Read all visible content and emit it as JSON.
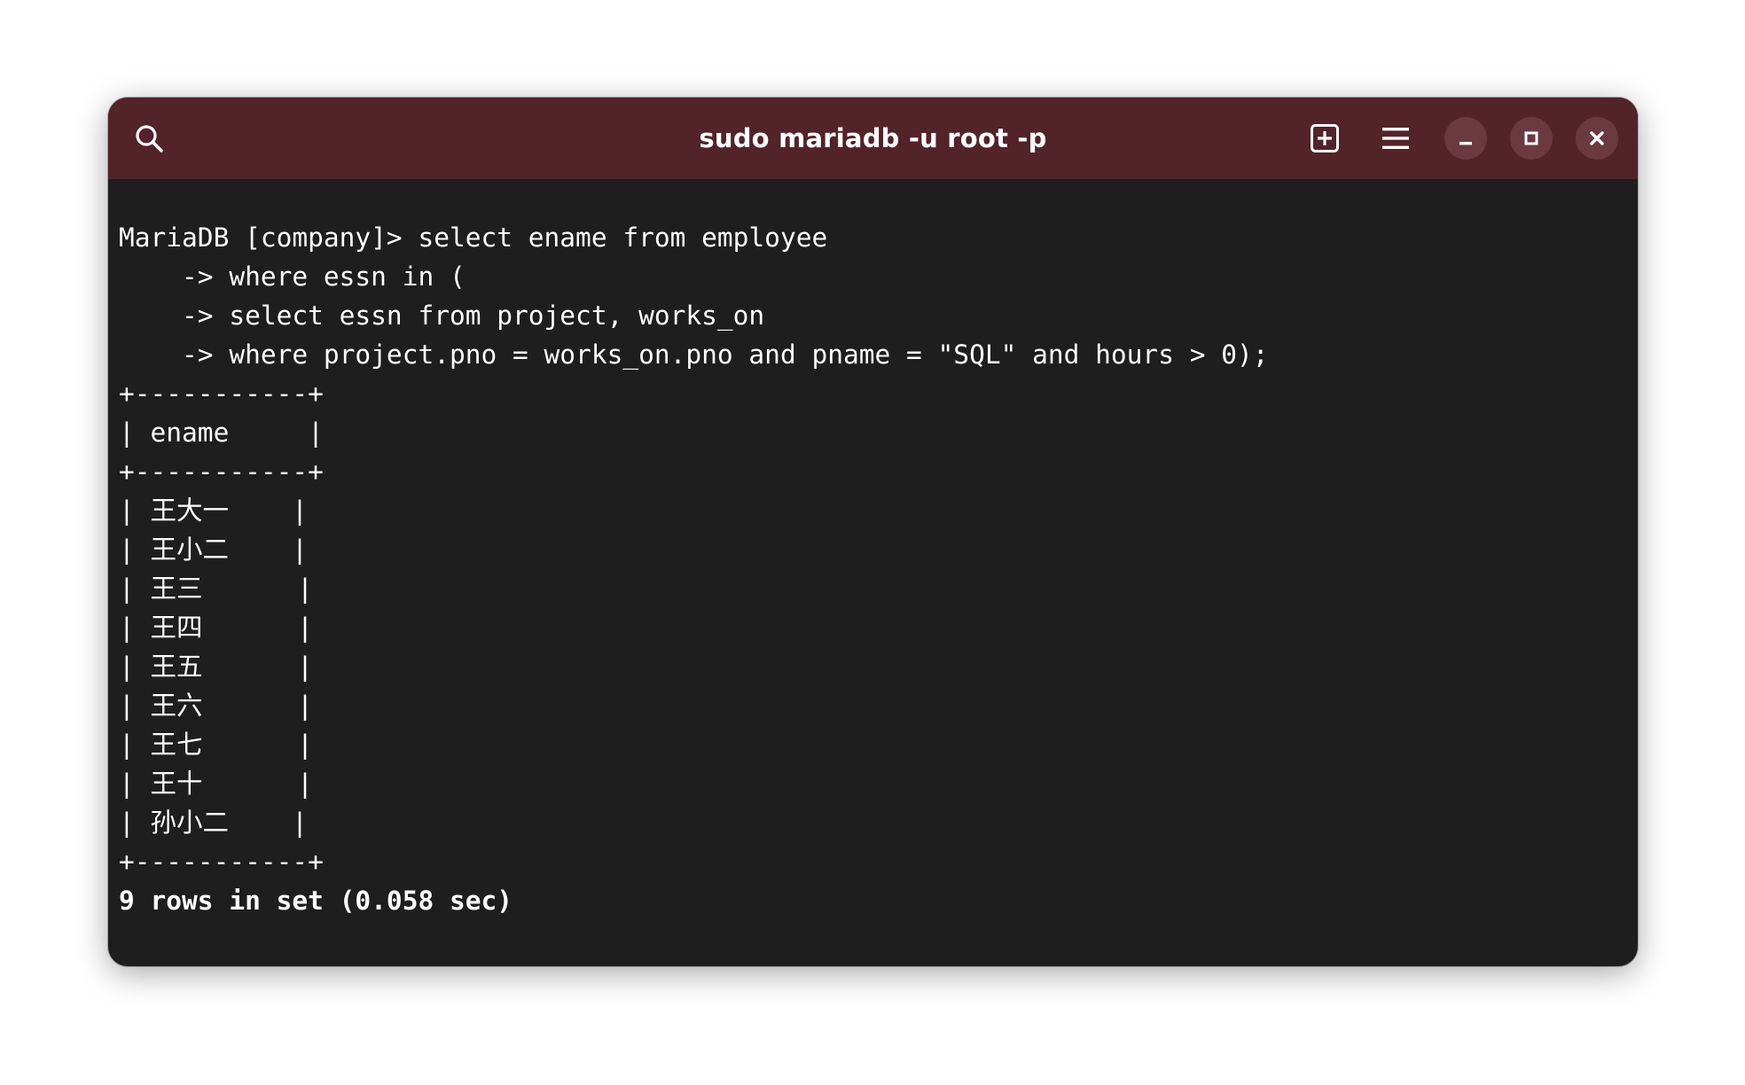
{
  "window": {
    "title": "sudo mariadb -u root -p",
    "titlebar_color": "#522329",
    "background_color": "#1e1e1e"
  },
  "icons": {
    "search": "search-icon",
    "new_tab": "new-tab-icon",
    "menu": "hamburger-menu-icon",
    "minimize": "minimize-icon",
    "maximize": "maximize-icon",
    "close": "close-icon"
  },
  "terminal": {
    "lines": [
      "MariaDB [company]> select ename from employee",
      "    -> where essn in (",
      "    -> select essn from project, works_on",
      "    -> where project.pno = works_on.pno and pname = \"SQL\" and hours > 0);",
      "+-----------+",
      "| ename     |",
      "+-----------+",
      "| 王大一    |",
      "| 王小二    |",
      "| 王三      |",
      "| 王四      |",
      "| 王五      |",
      "| 王六      |",
      "| 王七      |",
      "| 王十      |",
      "| 孙小二    |",
      "+-----------+"
    ],
    "summary": "9 rows in set (0.058 sec)"
  }
}
